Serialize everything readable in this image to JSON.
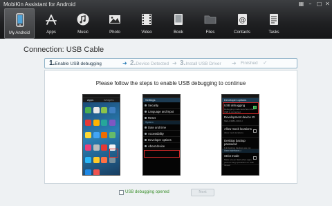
{
  "window": {
    "title": "MobiKin Assistant for Android"
  },
  "nav": {
    "items": [
      {
        "label": "My Android",
        "icon": "android-phone-icon",
        "active": true
      },
      {
        "label": "Apps",
        "icon": "app-store-icon"
      },
      {
        "label": "Music",
        "icon": "music-icon"
      },
      {
        "label": "Photo",
        "icon": "photo-icon"
      },
      {
        "label": "Video",
        "icon": "video-icon"
      },
      {
        "label": "Book",
        "icon": "book-icon"
      },
      {
        "label": "Files",
        "icon": "folder-icon"
      },
      {
        "label": "Contacts",
        "icon": "contacts-icon"
      },
      {
        "label": "Tasks",
        "icon": "tasks-icon"
      }
    ]
  },
  "connection_title": "Connection: USB Cable",
  "steps": [
    {
      "num": "1.",
      "label": "Enable USB debugging",
      "state": "current"
    },
    {
      "num": "2.",
      "label": "Device Detected",
      "state": "pending"
    },
    {
      "num": "3.",
      "label": "Install USB Driver",
      "state": "pending"
    },
    {
      "num": "",
      "label": "Finished",
      "state": "pending"
    }
  ],
  "instruction": "Please follow the steps to enable USB debugging to continue",
  "phone_screens": {
    "apps": {
      "tabs": [
        "Apps",
        "Widgets"
      ]
    },
    "settings": {
      "header": "Settings",
      "rows": [
        {
          "label": "Security"
        },
        {
          "label": "Language and input"
        },
        {
          "label": "Reset"
        },
        {
          "section": "System"
        },
        {
          "label": "Date and time"
        },
        {
          "label": "Accessibility"
        },
        {
          "label": "Developer options",
          "highlight": true
        },
        {
          "label": "About device"
        }
      ]
    },
    "developer": {
      "header": "Developer options",
      "rows": [
        {
          "title": "USB debugging",
          "sub": "Debugging mode launches when USB is connected",
          "checked": true,
          "highlight": true
        },
        {
          "title": "Development device ID",
          "sub": "MEIU-NB8F-O6CF-I",
          "checked": null
        },
        {
          "title": "Allow mock locations",
          "sub": "Allow mock locations",
          "checked": false
        },
        {
          "title": "Desktop backup password",
          "sub": "Full desktop backups are not currently protected",
          "checked": null
        },
        {
          "section": "User interface"
        },
        {
          "title": "Strict mode",
          "sub": "Make screen flash when apps perform long operations on main thread",
          "checked": false
        }
      ]
    }
  },
  "footer": {
    "checkbox_label": "USB debugging opened",
    "next_label": "Next"
  },
  "colors": {
    "topbar": "#1f2022",
    "step_active": "#1e3446",
    "step_inactive": "#a8b4bd",
    "highlight_red": "#d42a2a",
    "checkbox_label_green": "#3b8f2c"
  }
}
